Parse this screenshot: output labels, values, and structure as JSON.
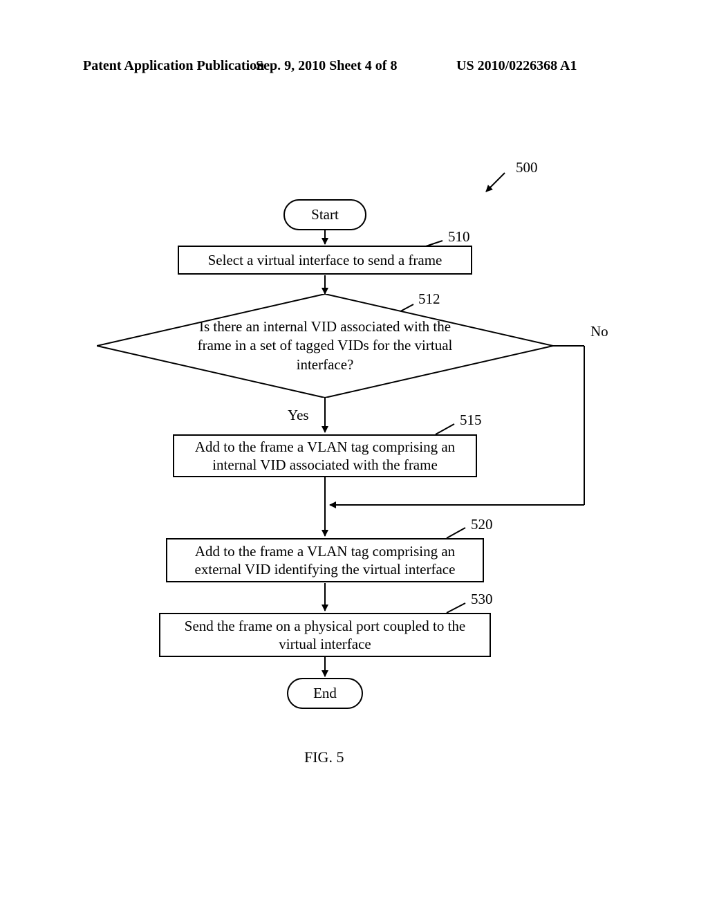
{
  "header": {
    "left": "Patent Application Publication",
    "mid": "Sep. 9, 2010   Sheet 4 of 8",
    "right": "US 2010/0226368 A1"
  },
  "refs": {
    "r500": "500",
    "r510": "510",
    "r512": "512",
    "r515": "515",
    "r520": "520",
    "r530": "530"
  },
  "branches": {
    "yes": "Yes",
    "no": "No"
  },
  "nodes": {
    "start": "Start",
    "step510": "Select a virtual interface to send a frame",
    "decision512": "Is there an internal VID associated with the frame in a set of tagged VIDs for the virtual interface?",
    "step515": "Add to the frame a VLAN tag comprising an internal VID associated with the frame",
    "step520": "Add to the frame a VLAN tag comprising an external VID identifying the virtual interface",
    "step530": "Send the frame on a physical port coupled to the virtual interface",
    "end": "End"
  },
  "figure_label": "FIG. 5"
}
